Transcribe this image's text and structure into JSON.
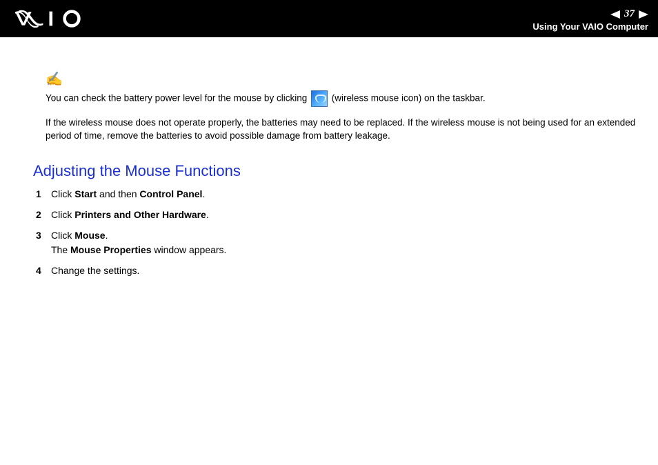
{
  "header": {
    "page_number": "37",
    "section_title": "Using Your VAIO Computer"
  },
  "note": {
    "line1_pre": "You can check the battery power level for the mouse by clicking ",
    "line1_post": " (wireless mouse icon) on the taskbar.",
    "line2": "If the wireless mouse does not operate properly, the batteries may need to be replaced. If the wireless mouse is not being used for an extended period of time, remove the batteries to avoid possible damage from battery leakage."
  },
  "section": {
    "title": "Adjusting the Mouse Functions"
  },
  "steps": {
    "s1": {
      "t1": "Click ",
      "b1": "Start",
      "t2": " and then ",
      "b2": "Control Panel",
      "t3": "."
    },
    "s2": {
      "t1": "Click ",
      "b1": "Printers and Other Hardware",
      "t2": "."
    },
    "s3": {
      "t1": "Click ",
      "b1": "Mouse",
      "t2": ".",
      "sub_t1": "The ",
      "sub_b1": "Mouse Properties",
      "sub_t2": " window appears."
    },
    "s4": {
      "t1": "Change the settings."
    }
  }
}
